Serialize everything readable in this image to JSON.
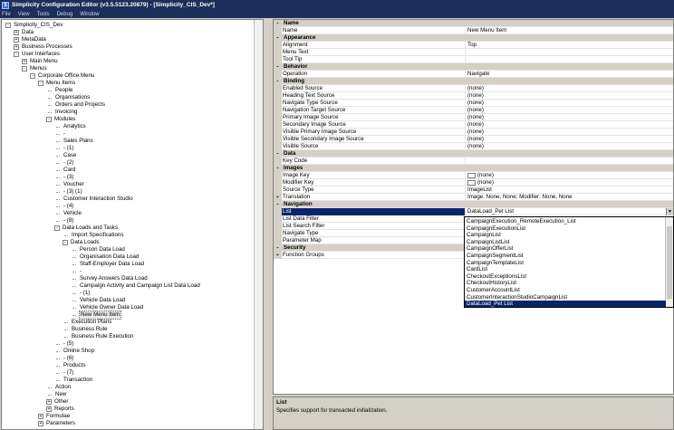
{
  "window": {
    "title": "Simplicity Configuration Editor (v3.5.5123.20879) - [Simplicity_CIS_Dev*]"
  },
  "menu": [
    "File",
    "View",
    "Tools",
    "Debug",
    "Window"
  ],
  "tree": [
    {
      "label": "Simplicity_CIS_Dev",
      "indent": 0,
      "exp": "-"
    },
    {
      "label": "Data",
      "indent": 1,
      "exp": "+"
    },
    {
      "label": "MetaData",
      "indent": 1,
      "exp": "+"
    },
    {
      "label": "Business Processes",
      "indent": 1,
      "exp": "+"
    },
    {
      "label": "User Interfaces",
      "indent": 1,
      "exp": "-"
    },
    {
      "label": "Main Menu",
      "indent": 2,
      "exp": "+"
    },
    {
      "label": "Menus",
      "indent": 2,
      "exp": "-"
    },
    {
      "label": "Corporate Office Menu",
      "indent": 3,
      "exp": "-"
    },
    {
      "label": "Menu Items",
      "indent": 4,
      "exp": "-"
    },
    {
      "label": "People",
      "indent": 5,
      "exp": ""
    },
    {
      "label": "Organisations",
      "indent": 5,
      "exp": ""
    },
    {
      "label": "Orders and Projects",
      "indent": 5,
      "exp": ""
    },
    {
      "label": "Invoicing",
      "indent": 5,
      "exp": ""
    },
    {
      "label": "Modules",
      "indent": 5,
      "exp": "-"
    },
    {
      "label": "Analytics",
      "indent": 6,
      "exp": ""
    },
    {
      "label": "-",
      "indent": 6,
      "exp": ""
    },
    {
      "label": "Sales Plans",
      "indent": 6,
      "exp": ""
    },
    {
      "label": "- (1)",
      "indent": 6,
      "exp": ""
    },
    {
      "label": "Case",
      "indent": 6,
      "exp": ""
    },
    {
      "label": "- (2)",
      "indent": 6,
      "exp": ""
    },
    {
      "label": "Card",
      "indent": 6,
      "exp": ""
    },
    {
      "label": "- (3)",
      "indent": 6,
      "exp": ""
    },
    {
      "label": "Voucher",
      "indent": 6,
      "exp": ""
    },
    {
      "label": "- (3) (1)",
      "indent": 6,
      "exp": ""
    },
    {
      "label": "Customer Interaction Studio",
      "indent": 6,
      "exp": ""
    },
    {
      "label": "- (4)",
      "indent": 6,
      "exp": ""
    },
    {
      "label": "Vehicle",
      "indent": 6,
      "exp": ""
    },
    {
      "label": "- (8)",
      "indent": 6,
      "exp": ""
    },
    {
      "label": "Data Loads and Tasks",
      "indent": 6,
      "exp": "-"
    },
    {
      "label": "Import Specifications",
      "indent": 7,
      "exp": ""
    },
    {
      "label": "Data Loads",
      "indent": 7,
      "exp": "-"
    },
    {
      "label": "Person Data Load",
      "indent": 8,
      "exp": ""
    },
    {
      "label": "Organisation Data Load",
      "indent": 8,
      "exp": ""
    },
    {
      "label": "Staff-Employer Data Load",
      "indent": 8,
      "exp": ""
    },
    {
      "label": "-",
      "indent": 8,
      "exp": ""
    },
    {
      "label": "Survey Answers Data Load",
      "indent": 8,
      "exp": ""
    },
    {
      "label": "Campaign Activity and Campaign List Data Load",
      "indent": 8,
      "exp": ""
    },
    {
      "label": "- (1)",
      "indent": 8,
      "exp": ""
    },
    {
      "label": "Vehicle Data Load",
      "indent": 8,
      "exp": ""
    },
    {
      "label": "Vehicle Owner Data Load",
      "indent": 8,
      "exp": ""
    },
    {
      "label": "New Menu Item",
      "indent": 8,
      "exp": "",
      "selected": true
    },
    {
      "label": "Execution Plans",
      "indent": 7,
      "exp": ""
    },
    {
      "label": "Business Rule",
      "indent": 7,
      "exp": ""
    },
    {
      "label": "Business Rule Execution",
      "indent": 7,
      "exp": ""
    },
    {
      "label": "- (5)",
      "indent": 6,
      "exp": ""
    },
    {
      "label": "Online Shop",
      "indent": 6,
      "exp": ""
    },
    {
      "label": "- (6)",
      "indent": 6,
      "exp": ""
    },
    {
      "label": "Products",
      "indent": 6,
      "exp": ""
    },
    {
      "label": "- (7)",
      "indent": 6,
      "exp": ""
    },
    {
      "label": "Transaction",
      "indent": 6,
      "exp": ""
    },
    {
      "label": "Action",
      "indent": 5,
      "exp": ""
    },
    {
      "label": "New",
      "indent": 5,
      "exp": ""
    },
    {
      "label": "Other",
      "indent": 5,
      "exp": "+"
    },
    {
      "label": "Reports",
      "indent": 5,
      "exp": "+"
    },
    {
      "label": "Formulae",
      "indent": 4,
      "exp": "+"
    },
    {
      "label": "Parameters",
      "indent": 4,
      "exp": "+"
    }
  ],
  "properties": [
    {
      "cat": "Name",
      "exp": "-"
    },
    {
      "name": "Name",
      "value": "New Menu Item"
    },
    {
      "cat": "Appearance",
      "exp": "-"
    },
    {
      "name": "Alignment",
      "value": "Top"
    },
    {
      "name": "Menu Text",
      "value": ""
    },
    {
      "name": "Tool Tip",
      "value": ""
    },
    {
      "cat": "Behavior",
      "exp": "-"
    },
    {
      "name": "Operation",
      "value": "Navigate"
    },
    {
      "cat": "Binding",
      "exp": "-"
    },
    {
      "name": "Enabled Source",
      "value": "(none)"
    },
    {
      "name": "Heading Text Source",
      "value": "(none)"
    },
    {
      "name": "Navigate Type Source",
      "value": "(none)"
    },
    {
      "name": "Navigation Target Source",
      "value": "(none)"
    },
    {
      "name": "Primary Image Source",
      "value": "(none)"
    },
    {
      "name": "Secondary Image Source",
      "value": "(none)"
    },
    {
      "name": "Visible Primary Image Source",
      "value": "(none)"
    },
    {
      "name": "Visible Secondary Image Source",
      "value": "(none)"
    },
    {
      "name": "Visible Source",
      "value": "(none)"
    },
    {
      "cat": "Data",
      "exp": "-"
    },
    {
      "name": "Key Code",
      "value": ""
    },
    {
      "cat": "Images",
      "exp": "-"
    },
    {
      "name": "Image Key",
      "value": "(none)",
      "swatch": true
    },
    {
      "name": "Modifier Key",
      "value": "(none)",
      "swatch": true
    },
    {
      "name": "Source Type",
      "value": "ImageList"
    },
    {
      "name": "Translation",
      "value": "Image: None, None; Modifier: None, None",
      "exp": "+"
    },
    {
      "cat": "Navigation",
      "exp": "-"
    },
    {
      "name": "List",
      "value": "DataLoad_Pet List",
      "selected": true,
      "dropdown": true
    },
    {
      "name": "List Data Filter",
      "value": ""
    },
    {
      "name": "List Search Filter",
      "value": ""
    },
    {
      "name": "Navigate Type",
      "value": ""
    },
    {
      "name": "Parameter Map",
      "value": ""
    },
    {
      "cat": "Security",
      "exp": "-"
    },
    {
      "name": "Function Groups",
      "value": "",
      "exp": "+"
    }
  ],
  "dropdown_items": [
    {
      "label": "CampaignExecution_RemoteExecution_List"
    },
    {
      "label": "CampaignExecutionList"
    },
    {
      "label": "CampaignList"
    },
    {
      "label": "CampaignListList"
    },
    {
      "label": "CampaignOfferList"
    },
    {
      "label": "CampaignSegmentList"
    },
    {
      "label": "CampaignTemplateList"
    },
    {
      "label": "CardList"
    },
    {
      "label": "CheckoutExceptionsList"
    },
    {
      "label": "CheckoutHistoryList"
    },
    {
      "label": "CustomerAccountList"
    },
    {
      "label": "CustomerInteractionStudioCampaignList"
    },
    {
      "label": "DataLoad_Pet List",
      "selected": true
    }
  ],
  "description": {
    "title": "List",
    "text": "Specifies support for transacted initialization."
  }
}
